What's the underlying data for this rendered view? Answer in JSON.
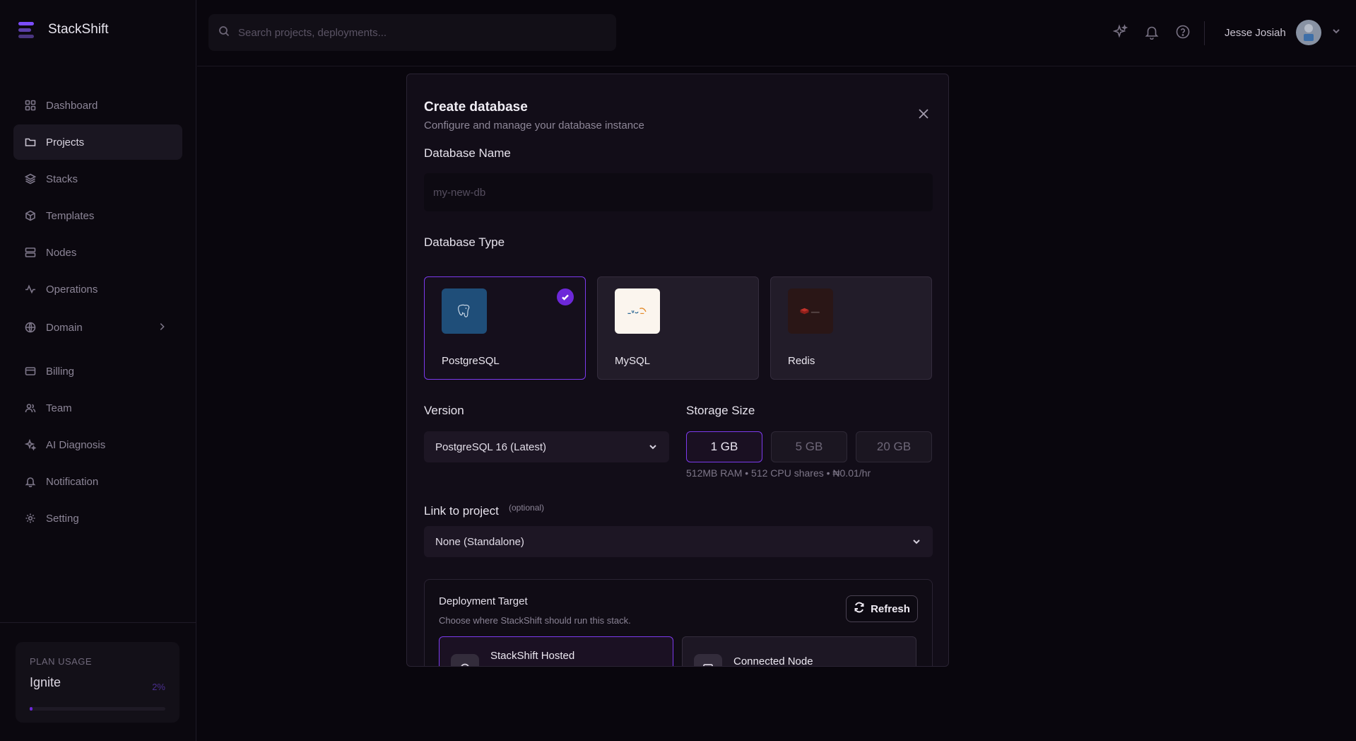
{
  "brand": {
    "name": "StackShift"
  },
  "search": {
    "placeholder": "Search projects, deployments..."
  },
  "sidebar": {
    "items": [
      {
        "label": "Dashboard",
        "icon": "grid-icon"
      },
      {
        "label": "Projects",
        "icon": "folder-icon",
        "active": true
      },
      {
        "label": "Stacks",
        "icon": "layers-icon"
      },
      {
        "label": "Templates",
        "icon": "box-icon"
      },
      {
        "label": "Nodes",
        "icon": "server-icon"
      },
      {
        "label": "Operations",
        "icon": "activity-icon"
      },
      {
        "label": "Domain",
        "icon": "globe-icon"
      },
      {
        "label": "Billing",
        "icon": "credit-card-icon"
      },
      {
        "label": "Team",
        "icon": "users-icon"
      },
      {
        "label": "AI Diagnosis",
        "icon": "sparkles-icon"
      },
      {
        "label": "Notification",
        "icon": "bell-icon"
      },
      {
        "label": "Setting",
        "icon": "gear-icon"
      }
    ]
  },
  "plan": {
    "label": "PLAN USAGE",
    "name": "Ignite",
    "percent_text": "2%",
    "percent": 2
  },
  "user": {
    "name": "Jesse Josiah"
  },
  "modal": {
    "title": "Create database",
    "subtitle": "Configure and manage your database instance",
    "name_label": "Database Name",
    "name_placeholder": "my-new-db",
    "type_label": "Database Type",
    "types": [
      {
        "name": "PostgreSQL",
        "selected": true
      },
      {
        "name": "MySQL",
        "selected": false
      },
      {
        "name": "Redis",
        "selected": false
      }
    ],
    "version_label": "Version",
    "version_value": "PostgreSQL 16 (Latest)",
    "storage_label": "Storage Size",
    "storage_options": [
      "1 GB",
      "5 GB",
      "20 GB"
    ],
    "storage_info": "512MB RAM • 512 CPU shares • ₦0.01/hr",
    "project_label": "Link to project",
    "project_optional": "(optional)",
    "project_value": "None (Standalone)",
    "target": {
      "title": "Deployment Target",
      "subtitle": "Choose where StackShift should run this stack.",
      "refresh_label": "Refresh",
      "options": [
        "StackShift Hosted",
        "Connected Node"
      ]
    }
  },
  "colors": {
    "accent": "#7c3aed",
    "background": "#09060d",
    "panel": "#120d18"
  }
}
